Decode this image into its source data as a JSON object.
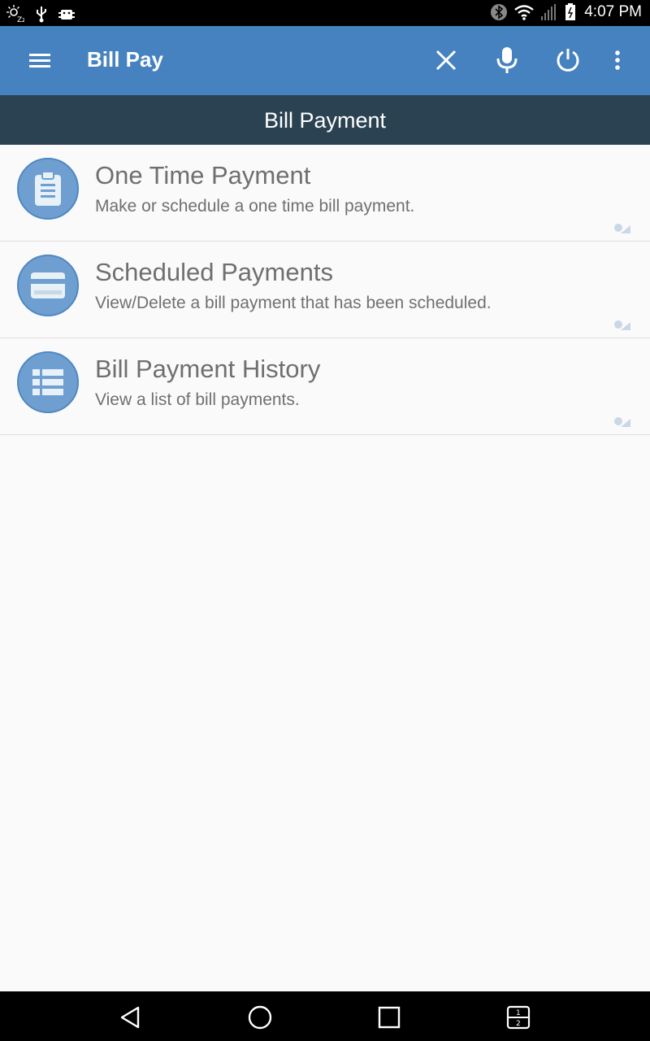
{
  "status_bar": {
    "time": "4:07 PM",
    "left_icons": [
      "sleep-icon",
      "usb-icon",
      "android-debug-icon"
    ],
    "right_icons": [
      "bluetooth-icon",
      "wifi-icon",
      "signal-icon",
      "battery-icon"
    ]
  },
  "appbar": {
    "title": "Bill Pay",
    "actions": [
      "close-icon",
      "microphone-icon",
      "power-icon",
      "overflow-menu-icon"
    ]
  },
  "section": {
    "title": "Bill Payment"
  },
  "items": [
    {
      "title": "One Time Payment",
      "subtitle": "Make or schedule a one time bill payment.",
      "icon": "clipboard-icon"
    },
    {
      "title": "Scheduled Payments",
      "subtitle": "View/Delete a bill payment that has been scheduled.",
      "icon": "credit-card-icon"
    },
    {
      "title": "Bill Payment History",
      "subtitle": "View a list of bill payments.",
      "icon": "list-icon"
    }
  ],
  "navbar": {
    "buttons": [
      "back-icon",
      "home-icon",
      "recents-icon",
      "split-screen-icon"
    ]
  },
  "colors": {
    "appbar": "#4582bf",
    "section_header": "#2b4252",
    "icon_circle": "#6e9fd0"
  }
}
